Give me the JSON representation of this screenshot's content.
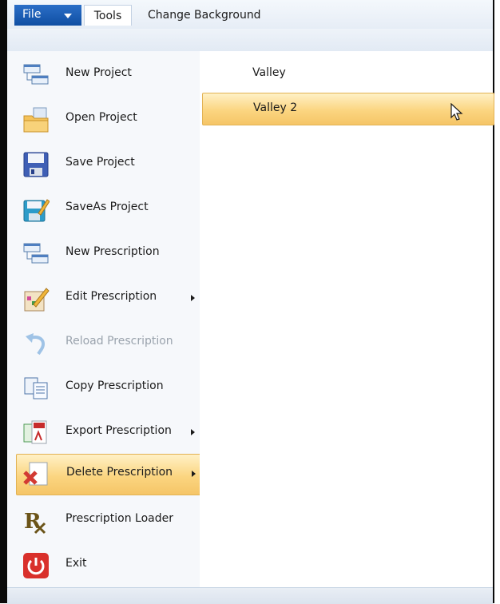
{
  "ribbon": {
    "file_label": "File",
    "tabs": [
      {
        "label": "Tools"
      },
      {
        "label": "Change Background"
      }
    ]
  },
  "file_menu": {
    "items": [
      {
        "label": "New Project",
        "icon": "new-project-icon",
        "enabled": true,
        "submenu": false
      },
      {
        "label": "Open Project",
        "icon": "open-folder-icon",
        "enabled": true,
        "submenu": false
      },
      {
        "label": "Save Project",
        "icon": "floppy-disk-icon",
        "enabled": true,
        "submenu": false
      },
      {
        "label": "SaveAs Project",
        "icon": "save-as-icon",
        "enabled": true,
        "submenu": false
      },
      {
        "label": "New Prescription",
        "icon": "new-prescription-icon",
        "enabled": true,
        "submenu": false
      },
      {
        "label": "Edit Prescription",
        "icon": "edit-pencil-icon",
        "enabled": true,
        "submenu": true
      },
      {
        "label": "Reload Prescription",
        "icon": "undo-arrow-icon",
        "enabled": false,
        "submenu": false
      },
      {
        "label": "Copy Prescription",
        "icon": "copy-icon",
        "enabled": true,
        "submenu": false
      },
      {
        "label": "Export Prescription",
        "icon": "export-pdf-icon",
        "enabled": true,
        "submenu": true
      },
      {
        "label": "Delete Prescription",
        "icon": "delete-document-icon",
        "enabled": true,
        "submenu": true,
        "highlighted": true
      },
      {
        "label": "Prescription Loader",
        "icon": "rx-icon",
        "enabled": true,
        "submenu": false
      },
      {
        "label": "Exit",
        "icon": "power-icon",
        "enabled": true,
        "submenu": false
      }
    ]
  },
  "submenu": {
    "items": [
      {
        "label": "Valley"
      },
      {
        "label": "Valley 2",
        "highlighted": true
      }
    ]
  },
  "colors": {
    "file_tab": "#1a5fb4",
    "highlight": "#fbd580",
    "disabled_text": "#9aa3ad",
    "exit_red": "#d9302b"
  }
}
